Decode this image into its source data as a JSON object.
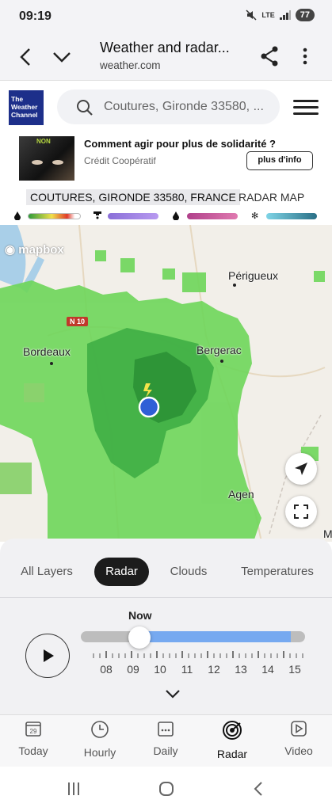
{
  "status_bar": {
    "time": "09:19",
    "network": "LTE",
    "battery": "77"
  },
  "browser": {
    "title": "Weather and radar...",
    "url": "weather.com"
  },
  "site": {
    "logo_text": "The Weather Channel",
    "search_placeholder": "Coutures, Gironde 33580, ..."
  },
  "ad": {
    "title": "Comment agir pour plus de solidarité ?",
    "sponsor": "Crédit Coopératif",
    "button": "plus d'info",
    "image_text": "NON"
  },
  "location": {
    "name": "COUTURES, GIRONDE 33580, FRANCE",
    "map_label": "RADAR MAP"
  },
  "legend": {
    "items": [
      {
        "icon": "rain-drop-icon",
        "colors": [
          "#2e9a3a",
          "#f0e04a",
          "#e03a2a",
          "#ffffff"
        ]
      },
      {
        "icon": "hail-icon",
        "colors": [
          "#8a6fd8",
          "#b89af0"
        ]
      },
      {
        "icon": "mix-drop-icon",
        "colors": [
          "#b0408a",
          "#e07ab0"
        ]
      },
      {
        "icon": "snowflake-icon",
        "colors": [
          "#7fd4e6",
          "#2a6f86"
        ]
      }
    ]
  },
  "map": {
    "attribution": "mapbox",
    "cities": [
      "Périgueux",
      "Bordeaux",
      "Bergerac",
      "Agen",
      "M"
    ],
    "road": "N 10"
  },
  "layers": {
    "tabs": [
      "All Layers",
      "Radar",
      "Clouds",
      "Temperatures"
    ],
    "active": "Radar"
  },
  "timeline": {
    "now_label": "Now",
    "hours": [
      "08",
      "09",
      "10",
      "11",
      "12",
      "13",
      "14",
      "15"
    ],
    "progress": 0.26
  },
  "bottom_nav": {
    "items": [
      {
        "label": "Today",
        "icon": "calendar-29-icon",
        "day": "29"
      },
      {
        "label": "Hourly",
        "icon": "clock-icon"
      },
      {
        "label": "Daily",
        "icon": "calendar-dots-icon"
      },
      {
        "label": "Radar",
        "icon": "radar-icon"
      },
      {
        "label": "Video",
        "icon": "play-square-icon"
      }
    ],
    "active": "Radar"
  }
}
